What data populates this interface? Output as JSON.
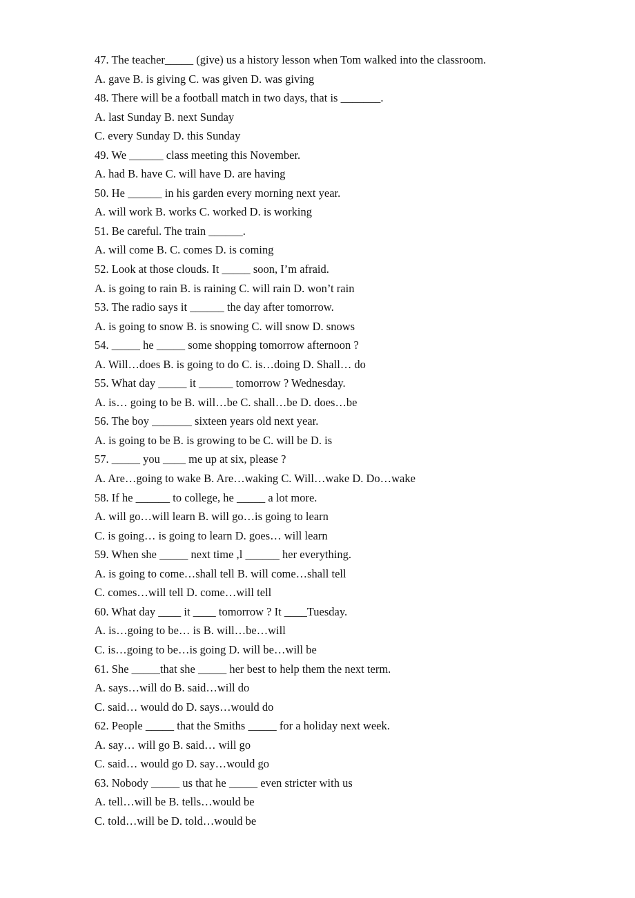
{
  "document": {
    "kind": "scanned-worksheet",
    "subject": "English grammar multiple-choice exercise",
    "page_background": "#ffffff",
    "text_color": "#121212",
    "item_range": "47-63"
  },
  "lines": [
    {
      "id": "q47",
      "type": "question",
      "number": "47",
      "text": "47. The teacher_____ (give) us a history lesson when Tom walked into the classroom."
    },
    {
      "id": "q47-opts",
      "type": "options",
      "number": "47",
      "text": "A. gave B. is giving C. was given D. was giving"
    },
    {
      "id": "q48",
      "type": "question",
      "number": "48",
      "text": "48. There will be a football match in two days, that is _______."
    },
    {
      "id": "q48-opts1",
      "type": "options",
      "number": "48",
      "text": "A. last Sunday B. next Sunday"
    },
    {
      "id": "q48-opts2",
      "type": "options",
      "number": "48",
      "text": "C. every Sunday D. this Sunday"
    },
    {
      "id": "q49",
      "type": "question",
      "number": "49",
      "text": "49. We ______ class meeting this November."
    },
    {
      "id": "q49-opts",
      "type": "options",
      "number": "49",
      "text": "A. had B. have C. will have D. are having"
    },
    {
      "id": "q50",
      "type": "question",
      "number": "50",
      "text": "50. He ______ in his garden every morning next year."
    },
    {
      "id": "q50-opts",
      "type": "options",
      "number": "50",
      "text": "A. will work B. works C. worked D. is working"
    },
    {
      "id": "q51",
      "type": "question",
      "number": "51",
      "text": "51. Be careful. The train ______."
    },
    {
      "id": "q51-opts",
      "type": "options",
      "number": "51",
      "text": "A. will come B. C. comes D. is coming"
    },
    {
      "id": "q52",
      "type": "question",
      "number": "52",
      "text": "52. Look at those clouds. It _____ soon, I’m afraid."
    },
    {
      "id": "q52-opts",
      "type": "options",
      "number": "52",
      "text": "A. is going to rain B. is raining C. will rain D. won’t rain"
    },
    {
      "id": "q53",
      "type": "question",
      "number": "53",
      "text": "53. The radio says it ______ the day after tomorrow."
    },
    {
      "id": "q53-opts",
      "type": "options",
      "number": "53",
      "text": "A. is going to snow B. is snowing C. will snow D. snows"
    },
    {
      "id": "q54",
      "type": "question",
      "number": "54",
      "text": "54. _____ he _____ some shopping tomorrow afternoon ?"
    },
    {
      "id": "q54-opts",
      "type": "options",
      "number": "54",
      "text": "A. Will…does B. is going to do C. is…doing D. Shall… do"
    },
    {
      "id": "q55",
      "type": "question",
      "number": "55",
      "text": "55. What day _____ it ______ tomorrow ? Wednesday."
    },
    {
      "id": "q55-opts",
      "type": "options",
      "number": "55",
      "text": "A. is… going to be B. will…be C. shall…be D. does…be"
    },
    {
      "id": "q56",
      "type": "question",
      "number": "56",
      "text": "56. The boy _______ sixteen years old next year."
    },
    {
      "id": "q56-opts",
      "type": "options",
      "number": "56",
      "text": "A. is going to be B. is growing to be C. will be D. is"
    },
    {
      "id": "q57",
      "type": "question",
      "number": "57",
      "text": "57. _____ you ____ me up at six, please ?"
    },
    {
      "id": "q57-opts",
      "type": "options",
      "number": "57",
      "text": "A. Are…going to wake B. Are…waking C. Will…wake D. Do…wake"
    },
    {
      "id": "q58",
      "type": "question",
      "number": "58",
      "text": "58. If he ______ to college, he _____ a lot more."
    },
    {
      "id": "q58-opts1",
      "type": "options",
      "number": "58",
      "text": "A. will go…will learn B. will go…is going to learn"
    },
    {
      "id": "q58-opts2",
      "type": "options",
      "number": "58",
      "text": "C. is going… is going to learn D. goes… will learn"
    },
    {
      "id": "q59",
      "type": "question",
      "number": "59",
      "text": "59. When she _____ next time ,l ______ her everything."
    },
    {
      "id": "q59-opts1",
      "type": "options",
      "number": "59",
      "text": "A. is going to come…shall tell B. will come…shall tell"
    },
    {
      "id": "q59-opts2",
      "type": "options",
      "number": "59",
      "text": "C. comes…will tell D. come…will tell"
    },
    {
      "id": "q60",
      "type": "question",
      "number": "60",
      "text": "60. What day ____ it ____ tomorrow ? It ____Tuesday."
    },
    {
      "id": "q60-opts1",
      "type": "options",
      "number": "60",
      "text": "A. is…going to be… is B. will…be…will"
    },
    {
      "id": "q60-opts2",
      "type": "options",
      "number": "60",
      "text": "C. is…going to be…is going D. will be…will be"
    },
    {
      "id": "q61",
      "type": "question",
      "number": "61",
      "text": "61. She _____that she _____ her best to help them the next term."
    },
    {
      "id": "q61-opts1",
      "type": "options",
      "number": "61",
      "text": "A. says…will do B. said…will do"
    },
    {
      "id": "q61-opts2",
      "type": "options",
      "number": "61",
      "text": "C. said… would do D. says…would do"
    },
    {
      "id": "q62",
      "type": "question",
      "number": "62",
      "text": "62. People _____ that the Smiths _____ for a holiday next week."
    },
    {
      "id": "q62-opts1",
      "type": "options",
      "number": "62",
      "text": "A. say… will go B. said… will go"
    },
    {
      "id": "q62-opts2",
      "type": "options",
      "number": "62",
      "text": "C. said… would go D. say…would go"
    },
    {
      "id": "q63",
      "type": "question",
      "number": "63",
      "text": "63. Nobody _____ us that he _____ even stricter with us"
    },
    {
      "id": "q63-opts1",
      "type": "options",
      "number": "63",
      "text": "A. tell…will be B. tells…would be"
    },
    {
      "id": "q63-opts2",
      "type": "options",
      "number": "63",
      "text": "C. told…will be D. told…would be"
    }
  ]
}
